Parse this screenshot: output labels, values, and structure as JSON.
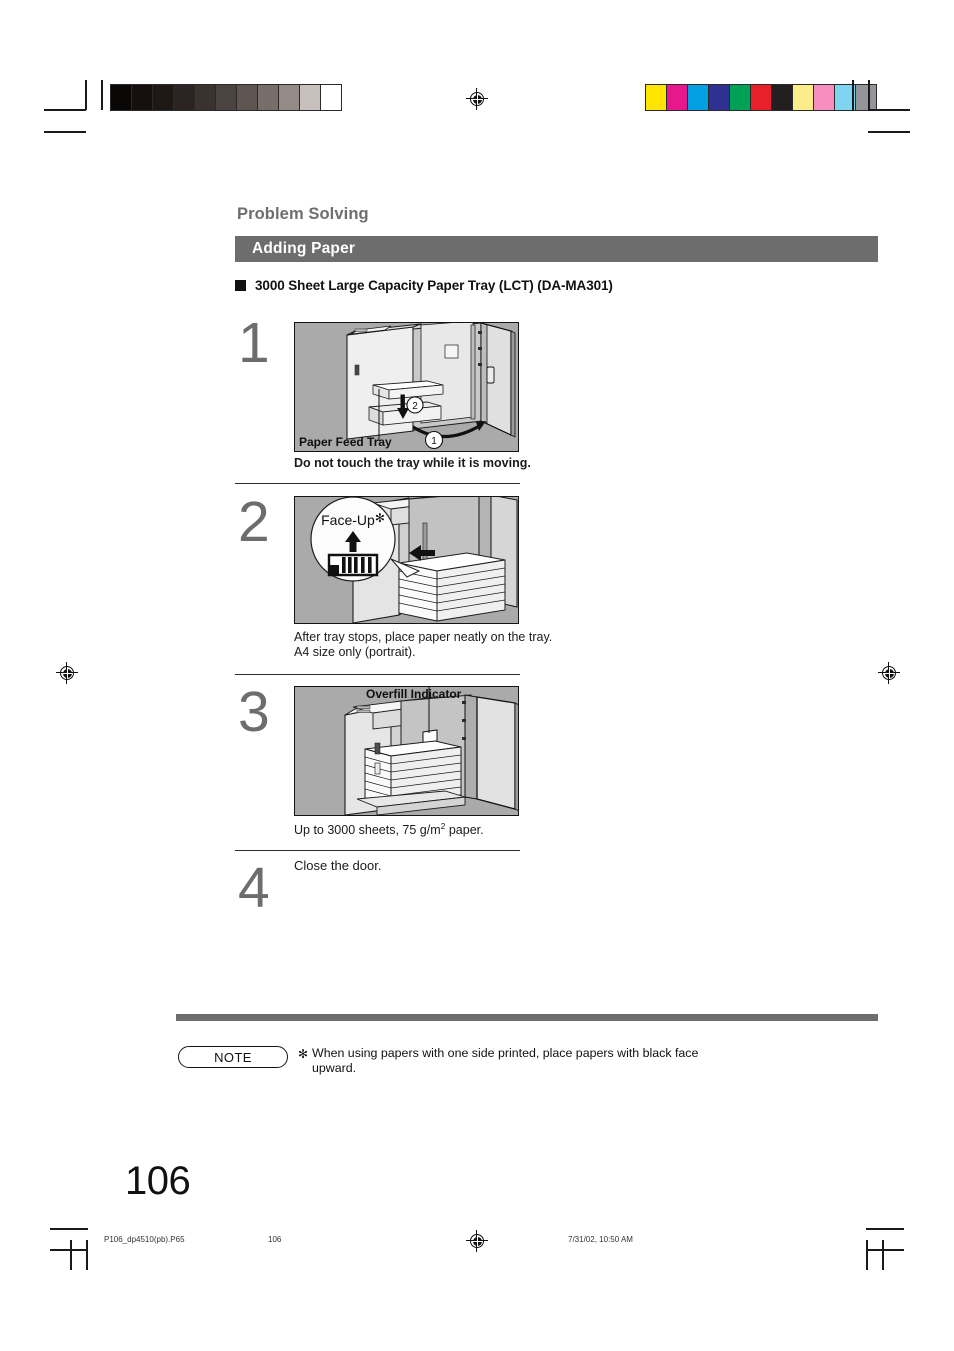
{
  "document": {
    "chapter_title": "Problem Solving",
    "section_title": "Adding Paper",
    "subsection_title": "3000 Sheet Large Capacity Paper Tray (LCT) (DA-MA301)",
    "page_number": "106"
  },
  "steps": [
    {
      "number": "1",
      "image_label": "Paper Feed Tray",
      "callout_1": "1",
      "callout_2": "2",
      "caption": "Do not touch the tray while it is moving.",
      "caption_bold": true
    },
    {
      "number": "2",
      "magnifier_label": "Face-Up",
      "magnifier_mark": "✻",
      "caption_line1": "After tray stops, place paper neatly on the tray.",
      "caption_line2": "A4 size only (portrait)."
    },
    {
      "number": "3",
      "image_label": "Overfill Indicator",
      "caption_prefix": "Up to 3000 sheets, 75 g/m",
      "caption_sup": "2",
      "caption_suffix": " paper."
    },
    {
      "number": "4",
      "caption": "Close the door."
    }
  ],
  "note": {
    "label": "NOTE",
    "marker": "✻",
    "text": "When using papers with one side printed, place papers with black face upward."
  },
  "footer": {
    "filename": "P106_dp4510(pb).P65",
    "page": "106",
    "timestamp": "7/31/02, 10:50 AM"
  },
  "print_marks": {
    "grayscale_swatches": [
      "#0a0807",
      "#15100e",
      "#1f1916",
      "#2b2422",
      "#3a322f",
      "#4b4340",
      "#5f5652",
      "#776d69",
      "#948a86",
      "#c8c0bc",
      "#ffffff"
    ],
    "color_swatches": [
      "#ffe400",
      "#e8188c",
      "#00a0e3",
      "#2e3192",
      "#00a154",
      "#e8202a",
      "#231f20",
      "#fbee8a",
      "#f68fc0",
      "#7fd4f2",
      "#939598"
    ]
  },
  "colors": {
    "section_bar": "#6d6d6d",
    "step_number": "#6d6d6d",
    "illustration_bg": "#aaaaaa",
    "text": "#111111"
  }
}
